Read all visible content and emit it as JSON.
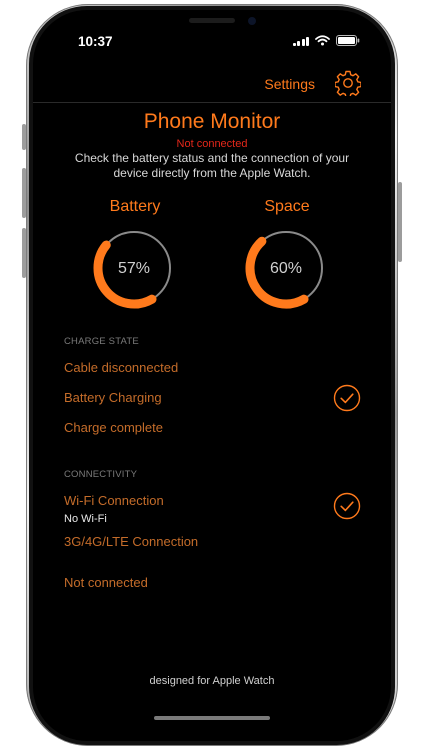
{
  "status_bar": {
    "time": "10:37",
    "icons": [
      "cellular-signal-icon",
      "wifi-icon",
      "battery-icon"
    ]
  },
  "nav": {
    "settings_label": "Settings",
    "settings_icon": "gear-icon"
  },
  "header": {
    "title": "Phone Monitor",
    "status": "Not connected",
    "description": "Check the battery status and the connection of your device directly from the Apple Watch."
  },
  "gauges": {
    "battery": {
      "label": "Battery",
      "value_text": "57%",
      "value": 57
    },
    "space": {
      "label": "Space",
      "value_text": "60%",
      "value": 60
    }
  },
  "charge_state": {
    "header": "CHARGE STATE",
    "items": [
      {
        "label": "Cable disconnected",
        "checked": false
      },
      {
        "label": "Battery Charging",
        "checked": true
      },
      {
        "label": "Charge complete",
        "checked": false
      }
    ]
  },
  "connectivity": {
    "header": "CONNECTIVITY",
    "items": [
      {
        "label": "Wi-Fi Connection",
        "detail": "No Wi-Fi",
        "checked": true
      },
      {
        "label": "3G/4G/LTE Connection",
        "detail": "",
        "checked": false
      },
      {
        "label": "Not connected",
        "detail": "",
        "checked": false
      }
    ]
  },
  "footer": "designed for Apple Watch",
  "colors": {
    "accent": "#ff7a1c",
    "error": "#e4271a",
    "track": "#8a8a8a",
    "background": "#000000"
  }
}
